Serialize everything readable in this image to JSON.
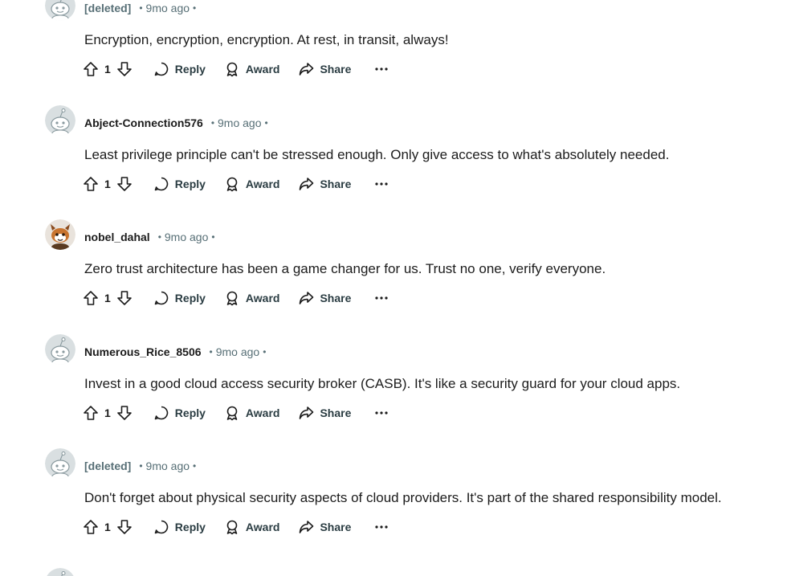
{
  "comments": [
    {
      "username": "[deleted]",
      "time": "9mo ago",
      "body": "Encryption, encryption, encryption. At rest, in transit, always!",
      "score": "1",
      "avatar_icon": "snoo-default-avatar-icon"
    },
    {
      "username": "Abject-Connection576",
      "time": "9mo ago",
      "body": "Least privilege principle can't be stressed enough. Only give access to what's absolutely needed.",
      "score": "1",
      "avatar_icon": "snoo-default-avatar-icon"
    },
    {
      "username": "nobel_dahal",
      "time": "9mo ago",
      "body": "Zero trust architecture has been a game changer for us. Trust no one, verify everyone.",
      "score": "1",
      "avatar_icon": "snoo-custom-avatar-icon"
    },
    {
      "username": "Numerous_Rice_8506",
      "time": "9mo ago",
      "body": "Invest in a good cloud access security broker (CASB). It's like a security guard for your cloud apps.",
      "score": "1",
      "avatar_icon": "snoo-default-avatar-icon"
    },
    {
      "username": "[deleted]",
      "time": "9mo ago",
      "body": "Don't forget about physical security aspects of cloud providers. It's part of the shared responsibility model.",
      "score": "1",
      "avatar_icon": "snoo-default-avatar-icon"
    }
  ],
  "actions": {
    "reply_label": "Reply",
    "award_label": "Award",
    "share_label": "Share",
    "separator": "•"
  },
  "colors": {
    "text": "#1c1c1c",
    "meta": "#576f76",
    "action": "#2a3c42",
    "avatar_gray": "#b8c3c7",
    "avatar_orange": "#c8742f"
  }
}
